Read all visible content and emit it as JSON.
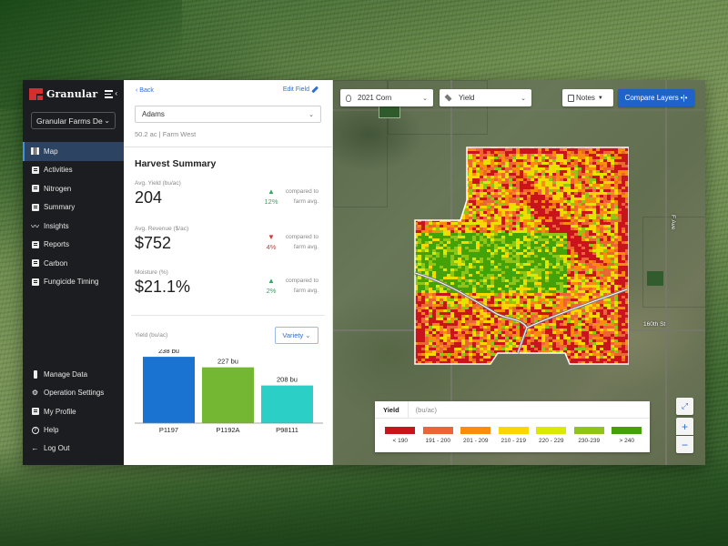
{
  "sidebar": {
    "brand": "Granular",
    "farm_select": "Granular Farms De",
    "nav_items": [
      {
        "label": "Map",
        "icon": "map-icon",
        "active": true
      },
      {
        "label": "Activities",
        "icon": "clipboard-icon"
      },
      {
        "label": "Nitrogen",
        "icon": "nitrogen-icon"
      },
      {
        "label": "Summary",
        "icon": "summary-icon"
      },
      {
        "label": "Insights",
        "icon": "trend-line-icon"
      },
      {
        "label": "Reports",
        "icon": "report-icon"
      },
      {
        "label": "Carbon",
        "icon": "carbon-icon"
      },
      {
        "label": "Fungicide Timing",
        "icon": "calendar-icon"
      }
    ],
    "bottom_items": [
      {
        "label": "Manage Data",
        "icon": "usb-drive-icon"
      },
      {
        "label": "Operation Settings",
        "icon": "gear-icon"
      },
      {
        "label": "My Profile",
        "icon": "profile-card-icon"
      },
      {
        "label": "Help",
        "icon": "help-icon"
      },
      {
        "label": "Log Out",
        "icon": "arrow-left-icon"
      }
    ]
  },
  "panel": {
    "back_label": "‹ Back",
    "edit_label": "Edit Field",
    "field_name": "Adams",
    "field_meta": "50.2 ac | Farm West",
    "summary_title": "Harvest Summary",
    "metrics": [
      {
        "label": "Avg. Yield (bu/ac)",
        "value": "204",
        "direction": "up",
        "arrow": "🡑",
        "delta": "12%",
        "compare_line1": "compared to",
        "compare_line2": "farm avg."
      },
      {
        "label": "Avg. Revenue ($/ac)",
        "value": "$752",
        "direction": "down",
        "arrow": "🡓",
        "delta": "4%",
        "compare_line1": "compared to",
        "compare_line2": "farm avg."
      },
      {
        "label": "Moisture (%)",
        "value": "$21.1%",
        "direction": "up",
        "arrow": "🡑",
        "delta": "2%",
        "compare_line1": "compared to",
        "compare_line2": "farm avg."
      }
    ],
    "chart_label": "Yield (bu/ac)",
    "variety_button": "Variety ⌄"
  },
  "chart_data": {
    "type": "bar",
    "title": "",
    "ylabel": "Yield (bu/ac)",
    "xlabel": "",
    "categories": [
      "P1197",
      "P1192A",
      "P98111"
    ],
    "values": [
      238,
      227,
      208
    ],
    "data_labels": [
      "238 bu",
      "227 bu",
      "208 bu"
    ],
    "colors": [
      "#1a73d0",
      "#74b733",
      "#2ccfc6"
    ],
    "ylim": [
      180,
      240
    ]
  },
  "map": {
    "season": "2021 Corn",
    "layer": "Yield",
    "notes": "Notes",
    "compare": "Compare Layers",
    "road_labels": [
      "F Ave",
      "160th St"
    ],
    "legend": {
      "title": "Yield",
      "unit": "(bu/ac)",
      "items": [
        {
          "label": "< 190",
          "color": "#c8141a"
        },
        {
          "label": "191 - 200",
          "color": "#ec6535"
        },
        {
          "label": "201 - 209",
          "color": "#fb8c0c"
        },
        {
          "label": "210 - 219",
          "color": "#fdd500"
        },
        {
          "label": "220 - 229",
          "color": "#dbe900"
        },
        {
          "label": "230-239",
          "color": "#8fc517"
        },
        {
          "label": "> 240",
          "color": "#44a208"
        }
      ]
    },
    "zoom_in": "+",
    "zoom_out": "−"
  }
}
